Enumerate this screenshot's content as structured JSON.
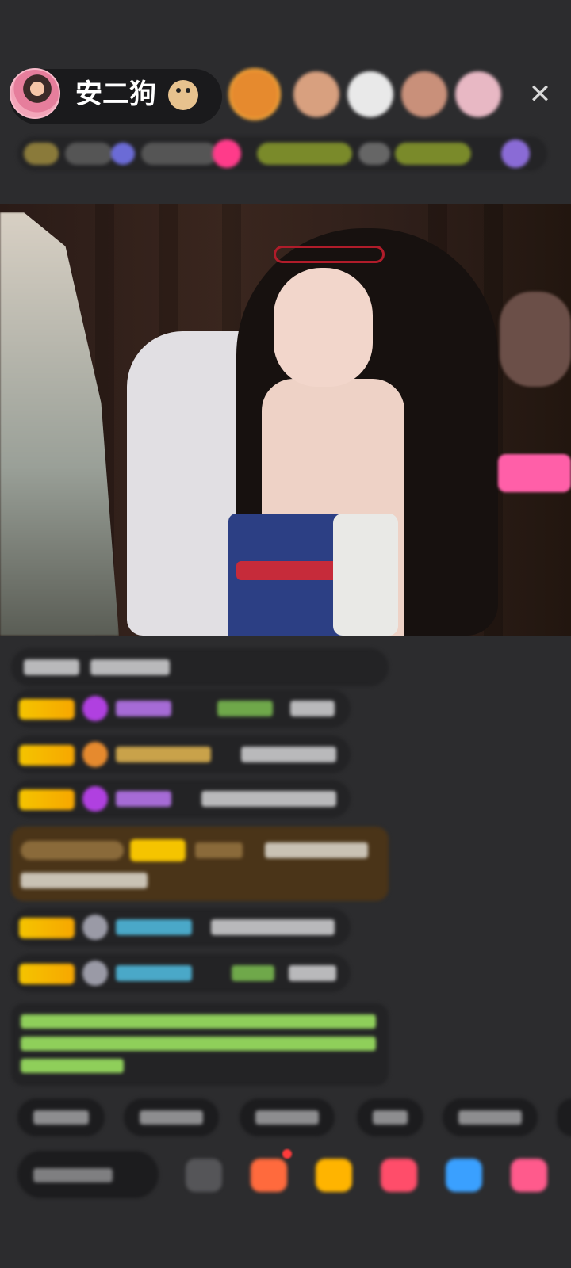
{
  "header": {
    "host_name": "安二狗",
    "host_emoji": "dog-face-icon",
    "close_icon": "close-icon",
    "close_glyph": "✕",
    "viewer_colors": [
      "#e68a2e",
      "#d8a07f",
      "#f0f0f0",
      "#c9907a",
      "#e8b8c4"
    ]
  },
  "video": {
    "description_icon": "live-stream-video"
  },
  "colors": {
    "background": "#2c2c2e",
    "badge_gold": "#f5c400",
    "gift_bar_gold": "#4a3418",
    "system_green": "#8fcf5a",
    "accent_pink": "#ff3b8a"
  },
  "bottom_bar": {
    "icons": [
      "emoji-icon",
      "gift-box-icon",
      "lucky-bag-icon",
      "red-packet-icon",
      "game-controller-icon",
      "more-apps-icon"
    ],
    "icon_colors": [
      "#555558",
      "#ff6a3d",
      "#ffb400",
      "#ff4d6a",
      "#3aa0ff",
      "#ff5a8c"
    ]
  }
}
